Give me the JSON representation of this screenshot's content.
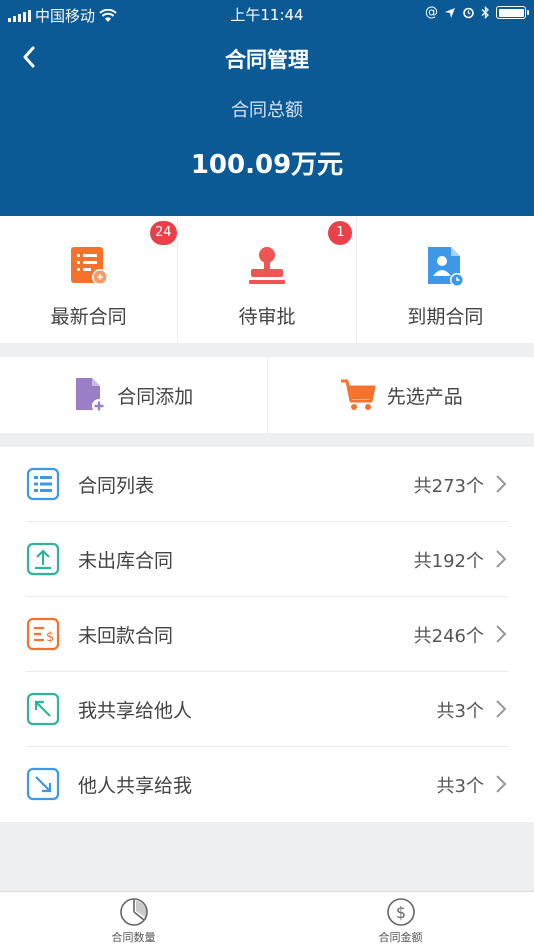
{
  "status_bar": {
    "carrier": "中国移动",
    "time": "上午11:44",
    "battery_level": 1.0
  },
  "header": {
    "title": "合同管理",
    "total_label": "合同总额",
    "total_value": "100.09万元"
  },
  "quick_items": [
    {
      "label": "最新合同",
      "badge": "24",
      "icon": "contract-new-icon",
      "color": "#f4722b"
    },
    {
      "label": "待审批",
      "badge": "1",
      "icon": "stamp-icon",
      "color": "#ee5553"
    },
    {
      "label": "到期合同",
      "badge": "",
      "icon": "expiring-contract-icon",
      "color": "#3d99e8"
    }
  ],
  "actions": [
    {
      "label": "合同添加",
      "icon": "add-document-icon",
      "color": "#9b7fc6"
    },
    {
      "label": "先选产品",
      "icon": "cart-icon",
      "color": "#f4722b"
    }
  ],
  "list": [
    {
      "label": "合同列表",
      "count": "共273个",
      "icon": "list-icon",
      "color": "#3d99e8"
    },
    {
      "label": "未出库合同",
      "count": "共192个",
      "icon": "upload-icon",
      "color": "#2fb39a"
    },
    {
      "label": "未回款合同",
      "count": "共246个",
      "icon": "payment-icon",
      "color": "#f4722b"
    },
    {
      "label": "我共享给他人",
      "count": "共3个",
      "icon": "share-out-icon",
      "color": "#2fb39a"
    },
    {
      "label": "他人共享给我",
      "count": "共3个",
      "icon": "share-in-icon",
      "color": "#3d99e8"
    }
  ],
  "tabs": [
    {
      "label": "合同数量",
      "icon": "pie-chart-icon"
    },
    {
      "label": "合同金额",
      "icon": "dollar-icon"
    }
  ],
  "colors": {
    "header_bg": "#0b5a96",
    "badge": "#e8414a"
  }
}
